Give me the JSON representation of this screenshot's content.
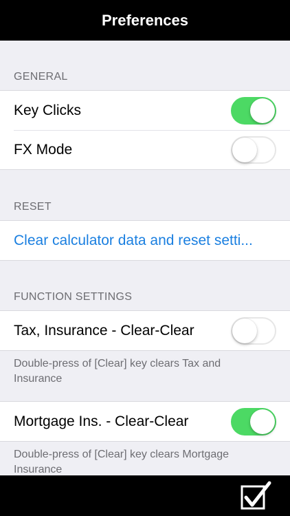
{
  "nav": {
    "title": "Preferences"
  },
  "general": {
    "header": "GENERAL",
    "key_clicks": {
      "label": "Key Clicks",
      "on": true
    },
    "fx_mode": {
      "label": "FX Mode",
      "on": false
    }
  },
  "reset": {
    "header": "RESET",
    "clear_label": "Clear calculator data and reset setti..."
  },
  "function_settings": {
    "header": "FUNCTION SETTINGS",
    "tax_insurance": {
      "label": "Tax, Insurance - Clear-Clear",
      "on": false,
      "note": "Double-press of [Clear] key clears Tax and Insurance"
    },
    "mortgage_ins": {
      "label": "Mortgage Ins. - Clear-Clear",
      "on": true,
      "note": "Double-press of [Clear] key clears Mortgage Insurance"
    }
  },
  "toolbar": {
    "done_icon": "checkbox-checkmark-icon"
  },
  "colors": {
    "accent": "#4cd964",
    "link": "#1a7fe0",
    "bar": "#000000"
  }
}
